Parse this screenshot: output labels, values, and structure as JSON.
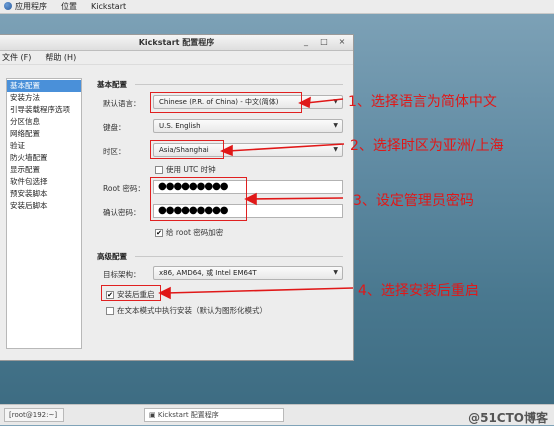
{
  "top_panel": {
    "apps": "应用程序",
    "places": "位置",
    "kickstart": "Kickstart"
  },
  "window": {
    "title": "Kickstart 配置程序",
    "controls": {
      "minimize": "_",
      "maximize": "□",
      "close": "×"
    },
    "menu": {
      "file": "文件 (F)",
      "help": "帮助 (H)"
    }
  },
  "sidebar": {
    "items": [
      {
        "label": "基本配置",
        "selected": true
      },
      {
        "label": "安装方法"
      },
      {
        "label": "引导装载程序选项"
      },
      {
        "label": "分区信息"
      },
      {
        "label": "网络配置"
      },
      {
        "label": "验证"
      },
      {
        "label": "防火墙配置"
      },
      {
        "label": "显示配置"
      },
      {
        "label": "软件包选择"
      },
      {
        "label": "预安装脚本"
      },
      {
        "label": "安装后脚本"
      }
    ]
  },
  "basic": {
    "section_title": "基本配置",
    "language_label": "默认语言：",
    "language_value": "Chinese (P.R. of China) - 中文(简体)",
    "keyboard_label": "键盘：",
    "keyboard_value": "U.S. English",
    "timezone_label": "时区：",
    "timezone_value": "Asia/Shanghai",
    "utc_label": "使用 UTC 时钟",
    "root_pw_label": "Root 密码：",
    "root_pw_value": "●●●●●●●●●",
    "confirm_pw_label": "确认密码：",
    "confirm_pw_value": "●●●●●●●●●",
    "encrypt_label": "给 root 密码加密",
    "encrypt_checked": "✔"
  },
  "advanced": {
    "section_title": "高级配置",
    "arch_label": "目标架构：",
    "arch_value": "x86, AMD64, 或 Intel EM64T",
    "reboot_label": "安装后重启",
    "reboot_checked": "✔",
    "textmode_label": "在文本模式中执行安装（默认为图形化模式）"
  },
  "annotations": {
    "a1": "1、选择语言为简体中文",
    "a2": "2、选择时区为亚洲/上海",
    "a3": "3、设定管理员密码",
    "a4": "4、选择安装后重启"
  },
  "taskbar": {
    "terminal": "[root@192:~]",
    "kickstart": "Kickstart 配置程序",
    "watermark": "@51CTO博客"
  },
  "colors": {
    "annotation": "#e01818",
    "selection": "#4a90d9"
  }
}
